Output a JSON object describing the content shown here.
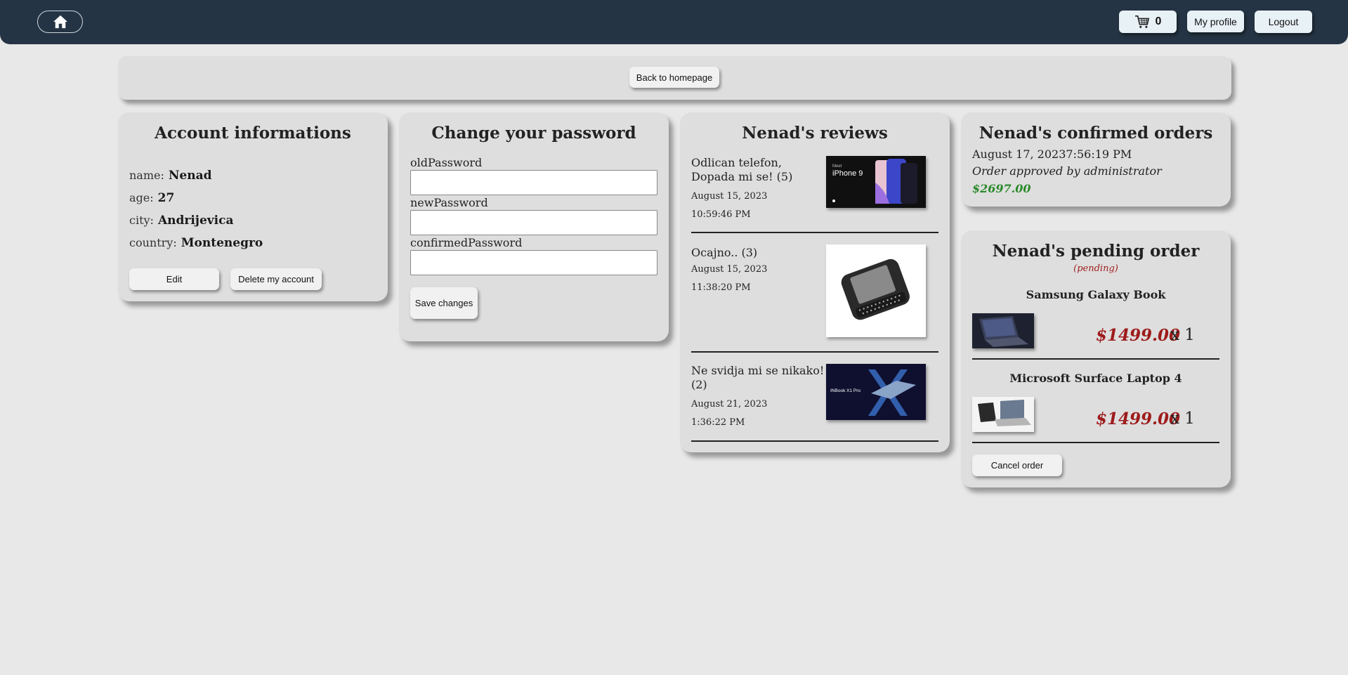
{
  "nav": {
    "cart_count": "0",
    "profile_label": "My profile",
    "logout_label": "Logout"
  },
  "top": {
    "back_label": "Back to homepage"
  },
  "account": {
    "title": "Account informations",
    "rows": [
      {
        "label": "name:",
        "value": "Nenad"
      },
      {
        "label": "age:",
        "value": "27"
      },
      {
        "label": "city:",
        "value": "Andrijevica"
      },
      {
        "label": "country:",
        "value": "Montenegro"
      }
    ],
    "edit_label": "Edit",
    "delete_label": "Delete my account"
  },
  "password": {
    "title": "Change your password",
    "fields": [
      {
        "label": "oldPassword",
        "value": ""
      },
      {
        "label": "newPassword",
        "value": ""
      },
      {
        "label": "confirmedPassword",
        "value": ""
      }
    ],
    "save_label": "Save changes"
  },
  "reviews": {
    "title": "Nenad's reviews",
    "items": [
      {
        "text": "Odlican telefon, Dopada mi se! (5)",
        "date": "August 15, 2023",
        "time": "10:59:46 PM",
        "image": "iphone-9-promo-image"
      },
      {
        "text": "Ocajno.. (3)",
        "date": "August 15, 2023",
        "time": "11:38:20 PM",
        "image": "keyboard-phone-image"
      },
      {
        "text": "Ne svidja mi se nikako! (2)",
        "date": "August 21, 2023",
        "time": "1:36:22 PM",
        "image": "inbook-laptop-image"
      }
    ]
  },
  "confirmed": {
    "title": "Nenad's confirmed orders",
    "date": "August 17, 20237:56:19 PM",
    "status": "Order approved by administrator",
    "price": "$2697.00",
    "price_color": "#2a8a2a"
  },
  "pending": {
    "title": "Nenad's pending order",
    "subtitle": "(pending)",
    "items": [
      {
        "name": "Samsung Galaxy Book",
        "price": "$1499.00",
        "qty": "x 1",
        "image": "samsung-galaxy-book-image"
      },
      {
        "name": "Microsoft Surface Laptop 4",
        "price": "$1499.00",
        "qty": "x 1",
        "image": "surface-laptop-image"
      }
    ],
    "cancel_label": "Cancel order",
    "price_color": "#9e1b1b"
  },
  "colors": {
    "navbar": "#253444",
    "background": "#e8e8e8",
    "card": "#dedede"
  },
  "icons": [
    "home-icon",
    "cart-icon"
  ]
}
